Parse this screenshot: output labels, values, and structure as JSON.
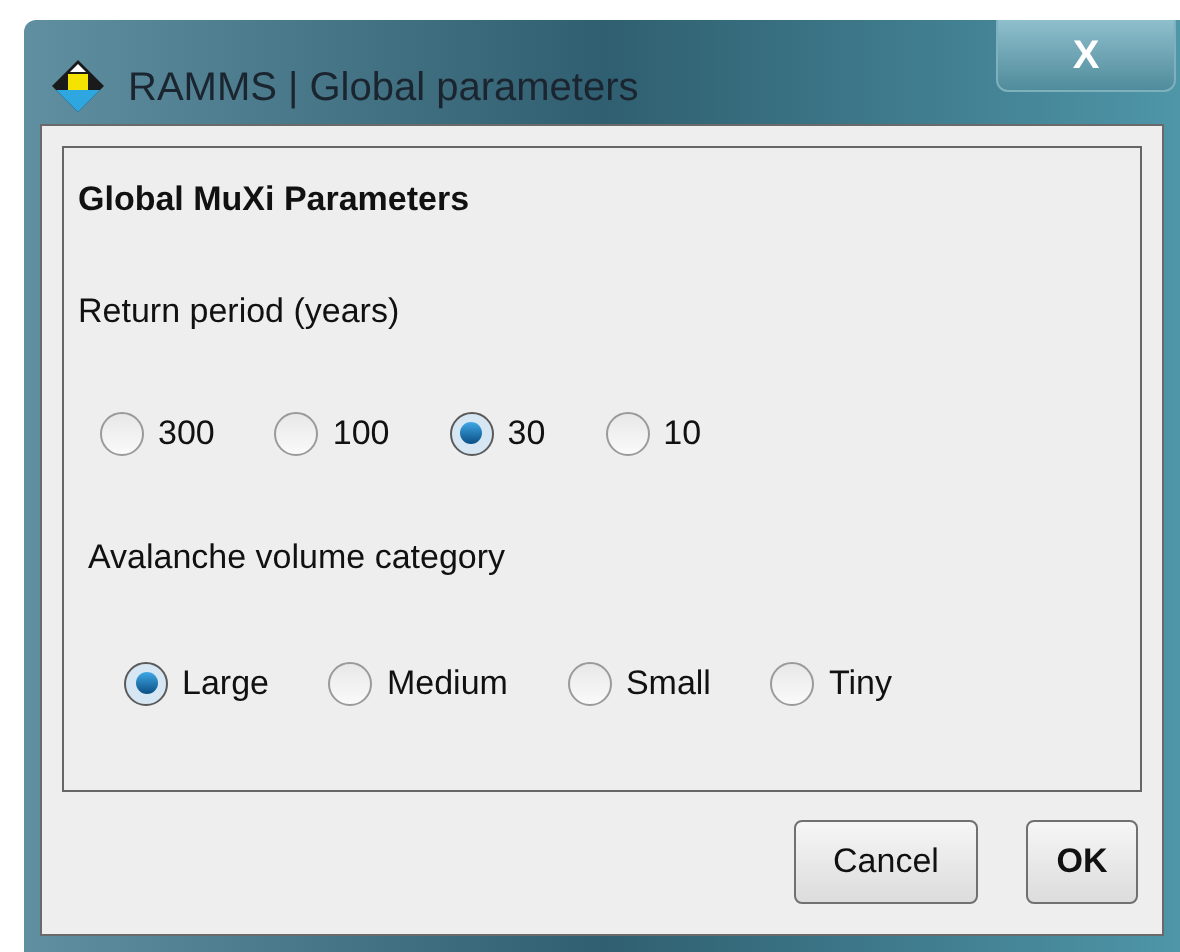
{
  "window": {
    "title": "RAMMS | Global parameters",
    "close": "X"
  },
  "panel": {
    "heading": "Global MuXi Parameters"
  },
  "return_period": {
    "label": "Return period (years)",
    "options": [
      {
        "label": "300",
        "selected": false
      },
      {
        "label": "100",
        "selected": false
      },
      {
        "label": "30",
        "selected": true
      },
      {
        "label": "10",
        "selected": false
      }
    ]
  },
  "volume_category": {
    "label": "Avalanche volume category",
    "options": [
      {
        "label": "Large",
        "selected": true
      },
      {
        "label": "Medium",
        "selected": false
      },
      {
        "label": "Small",
        "selected": false
      },
      {
        "label": "Tiny",
        "selected": false
      }
    ]
  },
  "buttons": [
    {
      "label": "Cancel",
      "kind": "cancel"
    },
    {
      "label": "OK",
      "kind": "ok"
    }
  ]
}
